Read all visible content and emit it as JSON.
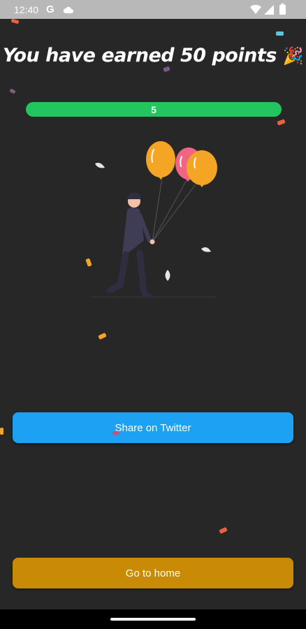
{
  "status_bar": {
    "time": "12:40",
    "carrier_icon": "G",
    "icons": [
      "cloud-icon",
      "wifi-icon",
      "signal-icon",
      "battery-icon"
    ]
  },
  "title": {
    "text": "You have earned 50 points",
    "emoji": "🎉"
  },
  "progress": {
    "label": "5",
    "fill": 1.0,
    "color": "#22c55e"
  },
  "illustration": {
    "icon": "person-with-balloons-illustration",
    "balloon_colors": [
      "#f5a524",
      "#f06582",
      "#f5a524"
    ]
  },
  "buttons": {
    "share_twitter": "Share on Twitter",
    "go_home": "Go to home"
  },
  "colors": {
    "background": "#272727",
    "twitter_button": "#1da1f2",
    "home_button": "#c98a06"
  }
}
